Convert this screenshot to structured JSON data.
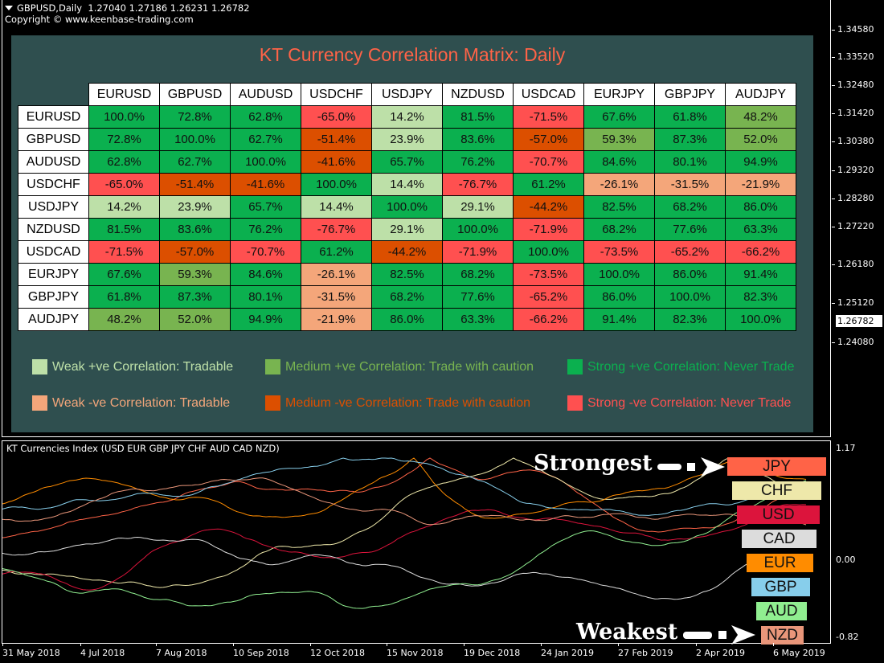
{
  "chart_header": {
    "symbol": "GBPUSD,Daily",
    "ohlc": "1.27040 1.27186 1.26231 1.26782",
    "copyright": "Copyright © www.keenbase-trading.com"
  },
  "price_axis": {
    "ticks": [
      "1.34580",
      "1.33520",
      "1.32480",
      "1.31420",
      "1.30380",
      "1.29320",
      "1.28280",
      "1.27220",
      "1.26180",
      "1.25120",
      "1.24080"
    ],
    "current_price": "1.26782"
  },
  "matrix": {
    "title": "KT Currency Correlation Matrix: Daily",
    "pairs": [
      "EURUSD",
      "GBPUSD",
      "AUDUSD",
      "USDCHF",
      "USDJPY",
      "NZDUSD",
      "USDCAD",
      "EURJPY",
      "GBPJPY",
      "AUDJPY"
    ],
    "rows": [
      {
        "label": "EURUSD",
        "cells": [
          {
            "v": "100.0%",
            "c": "sp"
          },
          {
            "v": "72.8%",
            "c": "sp"
          },
          {
            "v": "62.8%",
            "c": "sp"
          },
          {
            "v": "-65.0%",
            "c": "sn"
          },
          {
            "v": "14.2%",
            "c": "wp"
          },
          {
            "v": "81.5%",
            "c": "sp"
          },
          {
            "v": "-71.5%",
            "c": "sn"
          },
          {
            "v": "67.6%",
            "c": "sp"
          },
          {
            "v": "61.8%",
            "c": "sp"
          },
          {
            "v": "48.2%",
            "c": "mp"
          }
        ]
      },
      {
        "label": "GBPUSD",
        "cells": [
          {
            "v": "72.8%",
            "c": "sp"
          },
          {
            "v": "100.0%",
            "c": "sp"
          },
          {
            "v": "62.7%",
            "c": "sp"
          },
          {
            "v": "-51.4%",
            "c": "mn"
          },
          {
            "v": "23.9%",
            "c": "wp"
          },
          {
            "v": "83.6%",
            "c": "sp"
          },
          {
            "v": "-57.0%",
            "c": "mn"
          },
          {
            "v": "59.3%",
            "c": "mp"
          },
          {
            "v": "87.3%",
            "c": "sp"
          },
          {
            "v": "52.0%",
            "c": "mp"
          }
        ]
      },
      {
        "label": "AUDUSD",
        "cells": [
          {
            "v": "62.8%",
            "c": "sp"
          },
          {
            "v": "62.7%",
            "c": "sp"
          },
          {
            "v": "100.0%",
            "c": "sp"
          },
          {
            "v": "-41.6%",
            "c": "mn"
          },
          {
            "v": "65.7%",
            "c": "sp"
          },
          {
            "v": "76.2%",
            "c": "sp"
          },
          {
            "v": "-70.7%",
            "c": "sn"
          },
          {
            "v": "84.6%",
            "c": "sp"
          },
          {
            "v": "80.1%",
            "c": "sp"
          },
          {
            "v": "94.9%",
            "c": "sp"
          }
        ]
      },
      {
        "label": "USDCHF",
        "cells": [
          {
            "v": "-65.0%",
            "c": "sn"
          },
          {
            "v": "-51.4%",
            "c": "mn"
          },
          {
            "v": "-41.6%",
            "c": "mn"
          },
          {
            "v": "100.0%",
            "c": "sp"
          },
          {
            "v": "14.4%",
            "c": "wp"
          },
          {
            "v": "-76.7%",
            "c": "sn"
          },
          {
            "v": "61.2%",
            "c": "sp"
          },
          {
            "v": "-26.1%",
            "c": "wn"
          },
          {
            "v": "-31.5%",
            "c": "wn"
          },
          {
            "v": "-21.9%",
            "c": "wn"
          }
        ]
      },
      {
        "label": "USDJPY",
        "cells": [
          {
            "v": "14.2%",
            "c": "wp"
          },
          {
            "v": "23.9%",
            "c": "wp"
          },
          {
            "v": "65.7%",
            "c": "sp"
          },
          {
            "v": "14.4%",
            "c": "wp"
          },
          {
            "v": "100.0%",
            "c": "sp"
          },
          {
            "v": "29.1%",
            "c": "wp"
          },
          {
            "v": "-44.2%",
            "c": "mn"
          },
          {
            "v": "82.5%",
            "c": "sp"
          },
          {
            "v": "68.2%",
            "c": "sp"
          },
          {
            "v": "86.0%",
            "c": "sp"
          }
        ]
      },
      {
        "label": "NZDUSD",
        "cells": [
          {
            "v": "81.5%",
            "c": "sp"
          },
          {
            "v": "83.6%",
            "c": "sp"
          },
          {
            "v": "76.2%",
            "c": "sp"
          },
          {
            "v": "-76.7%",
            "c": "sn"
          },
          {
            "v": "29.1%",
            "c": "wp"
          },
          {
            "v": "100.0%",
            "c": "sp"
          },
          {
            "v": "-71.9%",
            "c": "sn"
          },
          {
            "v": "68.2%",
            "c": "sp"
          },
          {
            "v": "77.6%",
            "c": "sp"
          },
          {
            "v": "63.3%",
            "c": "sp"
          }
        ]
      },
      {
        "label": "USDCAD",
        "cells": [
          {
            "v": "-71.5%",
            "c": "sn"
          },
          {
            "v": "-57.0%",
            "c": "mn"
          },
          {
            "v": "-70.7%",
            "c": "sn"
          },
          {
            "v": "61.2%",
            "c": "sp"
          },
          {
            "v": "-44.2%",
            "c": "mn"
          },
          {
            "v": "-71.9%",
            "c": "sn"
          },
          {
            "v": "100.0%",
            "c": "sp"
          },
          {
            "v": "-73.5%",
            "c": "sn"
          },
          {
            "v": "-65.2%",
            "c": "sn"
          },
          {
            "v": "-66.2%",
            "c": "sn"
          }
        ]
      },
      {
        "label": "EURJPY",
        "cells": [
          {
            "v": "67.6%",
            "c": "sp"
          },
          {
            "v": "59.3%",
            "c": "mp"
          },
          {
            "v": "84.6%",
            "c": "sp"
          },
          {
            "v": "-26.1%",
            "c": "wn"
          },
          {
            "v": "82.5%",
            "c": "sp"
          },
          {
            "v": "68.2%",
            "c": "sp"
          },
          {
            "v": "-73.5%",
            "c": "sn"
          },
          {
            "v": "100.0%",
            "c": "sp"
          },
          {
            "v": "86.0%",
            "c": "sp"
          },
          {
            "v": "91.4%",
            "c": "sp"
          }
        ]
      },
      {
        "label": "GBPJPY",
        "cells": [
          {
            "v": "61.8%",
            "c": "sp"
          },
          {
            "v": "87.3%",
            "c": "sp"
          },
          {
            "v": "80.1%",
            "c": "sp"
          },
          {
            "v": "-31.5%",
            "c": "wn"
          },
          {
            "v": "68.2%",
            "c": "sp"
          },
          {
            "v": "77.6%",
            "c": "sp"
          },
          {
            "v": "-65.2%",
            "c": "sn"
          },
          {
            "v": "86.0%",
            "c": "sp"
          },
          {
            "v": "100.0%",
            "c": "sp"
          },
          {
            "v": "82.3%",
            "c": "sp"
          }
        ]
      },
      {
        "label": "AUDJPY",
        "cells": [
          {
            "v": "48.2%",
            "c": "mp"
          },
          {
            "v": "52.0%",
            "c": "mp"
          },
          {
            "v": "94.9%",
            "c": "sp"
          },
          {
            "v": "-21.9%",
            "c": "wn"
          },
          {
            "v": "86.0%",
            "c": "sp"
          },
          {
            "v": "63.3%",
            "c": "sp"
          },
          {
            "v": "-66.2%",
            "c": "sn"
          },
          {
            "v": "91.4%",
            "c": "sp"
          },
          {
            "v": "82.3%",
            "c": "sp"
          },
          {
            "v": "100.0%",
            "c": "sp"
          }
        ]
      }
    ],
    "colors": {
      "wp": "#bde0a8",
      "mp": "#78b450",
      "sp": "#0bb04f",
      "wn": "#f4a67a",
      "mn": "#dc4f00",
      "sn": "#ff5050"
    },
    "legend": [
      {
        "key": "wp",
        "label": "Weak +ve Correlation: Tradable",
        "text_color": "#bde0a8"
      },
      {
        "key": "mp",
        "label": "Medium +ve Correlation: Trade with caution",
        "text_color": "#78b450"
      },
      {
        "key": "sp",
        "label": "Strong +ve Correlation: Never Trade",
        "text_color": "#0bb04f"
      },
      {
        "key": "wn",
        "label": "Weak -ve Correlation: Tradable",
        "text_color": "#f4a67a"
      },
      {
        "key": "mn",
        "label": "Medium -ve Correlation: Trade with caution",
        "text_color": "#dc4f00"
      },
      {
        "key": "sn",
        "label": "Strong -ve Correlation: Never Trade",
        "text_color": "#ff5050"
      }
    ]
  },
  "indicator": {
    "title": "KT Currencies Index (USD EUR GBP JPY CHF AUD CAD NZD)",
    "axis": {
      "max": "1.17",
      "zero": "0.00",
      "min": "-0.82"
    },
    "strongest_label": "Strongest",
    "weakest_label": "Weakest",
    "ranking": [
      {
        "currency": "JPY",
        "color": "#ff6347"
      },
      {
        "currency": "CHF",
        "color": "#eee8aa"
      },
      {
        "currency": "USD",
        "color": "#dc143c"
      },
      {
        "currency": "CAD",
        "color": "#dcdcdc"
      },
      {
        "currency": "EUR",
        "color": "#ff8c00"
      },
      {
        "currency": "GBP",
        "color": "#87ceeb"
      },
      {
        "currency": "AUD",
        "color": "#90ee90"
      },
      {
        "currency": "NZD",
        "color": "#e9967a"
      }
    ]
  },
  "time_axis": [
    "31 May 2018",
    "4 Jul 2018",
    "7 Aug 2018",
    "10 Sep 2018",
    "12 Oct 2018",
    "15 Nov 2018",
    "19 Dec 2018",
    "24 Jan 2019",
    "27 Feb 2019",
    "2 Apr 2019",
    "6 May 2019"
  ]
}
